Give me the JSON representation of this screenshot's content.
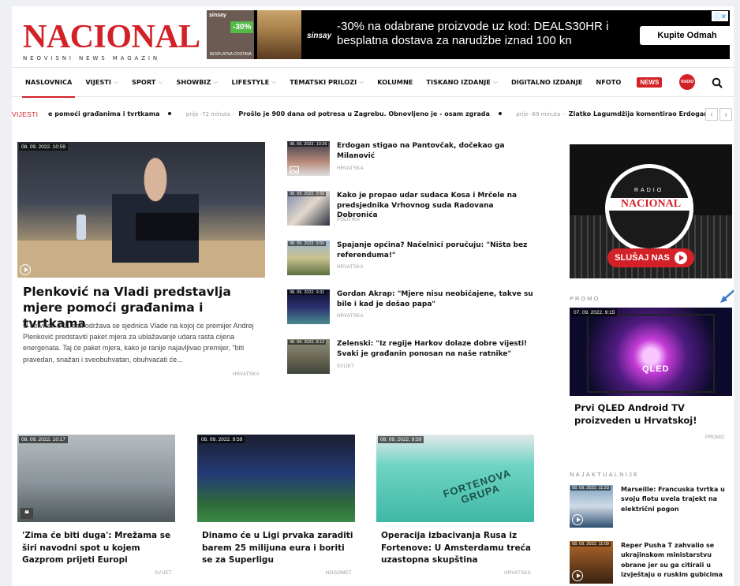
{
  "logo": {
    "main": "NACIONAL",
    "sub": "NEOVISNI NEWS MAGAZIN"
  },
  "ad": {
    "brand_small": "sinsay",
    "discount": "-30%",
    "tag": "BESPLATNA DOSTAVA",
    "brand": "sinsay",
    "text": "-30% na odabrane proizvode uz kod: DEALS30HR i besplatna dostava za narudžbe iznad 100 kn",
    "cta": "Kupite Odmah",
    "choice": "ⓘ✕"
  },
  "nav": {
    "items": [
      {
        "label": "NASLOVNICA",
        "dropdown": false,
        "active": true
      },
      {
        "label": "VIJESTI",
        "dropdown": true
      },
      {
        "label": "SPORT",
        "dropdown": true
      },
      {
        "label": "SHOWBIZ",
        "dropdown": true
      },
      {
        "label": "LIFESTYLE",
        "dropdown": true
      },
      {
        "label": "TEMATSKI PRILOZI",
        "dropdown": true
      },
      {
        "label": "KOLUMNE",
        "dropdown": false
      },
      {
        "label": "TISKANO IZDANJE",
        "dropdown": true
      },
      {
        "label": "DIGITALNO IZDANJE",
        "dropdown": false
      },
      {
        "label": "NFOTO",
        "dropdown": false
      }
    ],
    "news_badge": "NEWS",
    "radio_badge": "RADIO"
  },
  "ticker": {
    "label": "VIJESTI",
    "items": [
      {
        "time": "",
        "text": "e pomoći građanima i tvrtkama"
      },
      {
        "time": "prije -72 minuta -",
        "text": "Prošlo je 900 dana od potresa u Zagrebu. Obnovljeno je - osam zgrada"
      },
      {
        "time": "prije -69 minuta -",
        "text": "Zlatko Lagumdžija komentirao Erdoganovu izjavu: \"To je čista poru"
      }
    ],
    "prev": "‹",
    "next": "›"
  },
  "hero": {
    "date": "08. 09. 2022. 10:59",
    "title": "Plenković na Vladi predstavlja mjere pomoći građanima i tvrtkama",
    "text": "U četvrtak u 11 sati održava se sjednica Vlade na kojoj će premijer Andrej Plenković predstaviti paket mjera za ublažavanje udara rasta cijena energenata. Taj će paket mjera, kako je ranije najavljivao premijer, \"biti pravedan, snažan i sveobuhvatan, obuhvaćati će...",
    "category": "HRVATSKA"
  },
  "mid_list": [
    {
      "date": "08. 09. 2022. 10:26",
      "title": "Erdogan stigao na Pantovčak, dočekao ga Milanović",
      "category": "HRVATSKA"
    },
    {
      "date": "08. 09. 2022. 9:56",
      "title": "Kako je propao udar sudaca Kosa i Mrčele na predsjednika Vrhovnog suda Radovana Dobronića",
      "category": "POLITIKA"
    },
    {
      "date": "08. 09. 2022. 9:50",
      "title": "Spajanje općina? Načelnici poručuju: \"Ništa bez referenduma!\"",
      "category": "HRVATSKA"
    },
    {
      "date": "08. 09. 2022. 9:31",
      "title": "Gordan Akrap: \"Mjere nisu neobičajene, takve su bile i kad je došao papa\"",
      "category": "HRVATSKA"
    },
    {
      "date": "08. 09. 2022. 8:12",
      "title": "Zelenski: \"Iz regije Harkov dolaze dobre vijesti! Svaki je građanin ponosan na naše ratnike\"",
      "category": "SVIJET"
    }
  ],
  "radio": {
    "small": "RADIO",
    "name": "NACIONAL",
    "cta": "SLUŠAJ NAS"
  },
  "promo": {
    "label": "PROMO",
    "date": "07. 09. 2022. 9:15",
    "tv_text": "QLED",
    "title": "Prvi QLED Android TV proizveden u Hrvatskoj!",
    "category": "PROMO"
  },
  "latest": {
    "label": "NAJAKTUALNIJE",
    "items": [
      {
        "date": "08. 09. 2022. 11:23",
        "title": "Marseille: Francuska tvrtka u svoju flotu uvela trajekt na električni pogon"
      },
      {
        "date": "08. 09. 2022. 11:09",
        "title": "Reper Pusha T zahvalio se ukrajinskom ministarstvu obrane jer su ga citirali u izvještaju o ruskim gubicima"
      }
    ]
  },
  "bottom": [
    {
      "date": "08. 09. 2022. 10:17",
      "title": "'Zima će biti duga': Mrežama se širi navodni spot u kojem Gazprom prijeti Europi",
      "category": "SVIJET"
    },
    {
      "date": "08. 09. 2022. 9:59",
      "title": "Dinamo će u Ligi prvaka zaraditi barem 25 milijuna eura i boriti se za Superligu",
      "category": "NOGOMET"
    },
    {
      "date": "08. 09. 2022. 9:59",
      "title": "Operacija izbacivanja Rusa iz Fortenove: U Amsterdamu treća uzastopna skupština",
      "category": "HRVATSKA",
      "img_text": "FORTENOVA GRUPA"
    }
  ]
}
